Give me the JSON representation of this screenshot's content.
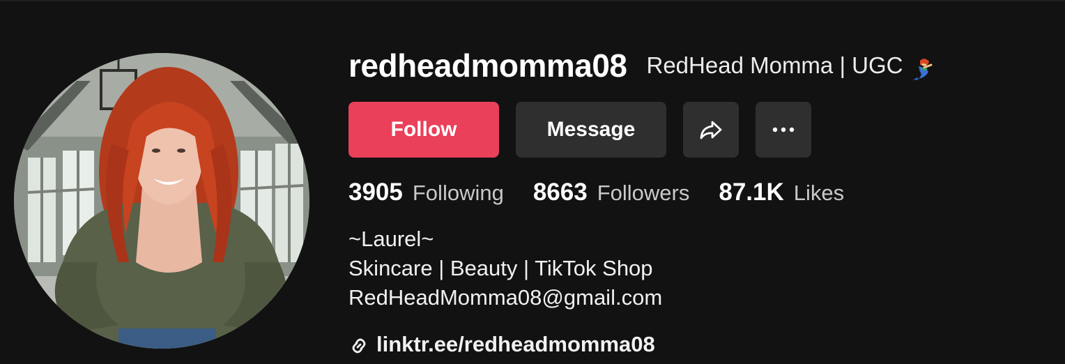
{
  "profile": {
    "username": "redheadmomma08",
    "nickname": "RedHead Momma | UGC",
    "nickname_emoji": "mermaid-emoji"
  },
  "actions": {
    "follow_label": "Follow",
    "message_label": "Message",
    "share_icon": "share-icon",
    "more_icon": "more-icon"
  },
  "stats": [
    {
      "value": "3905",
      "label": "Following"
    },
    {
      "value": "8663",
      "label": "Followers"
    },
    {
      "value": "87.1K",
      "label": "Likes"
    }
  ],
  "bio": {
    "lines": [
      "~Laurel~",
      "Skincare | Beauty | TikTok Shop",
      "RedHeadMomma08@gmail.com"
    ]
  },
  "link": {
    "text": "linktr.ee/redheadmomma08",
    "icon": "link-icon"
  },
  "colors": {
    "background": "#121212",
    "follow_button": "#ea405a",
    "secondary_button": "#2f2f2f"
  }
}
